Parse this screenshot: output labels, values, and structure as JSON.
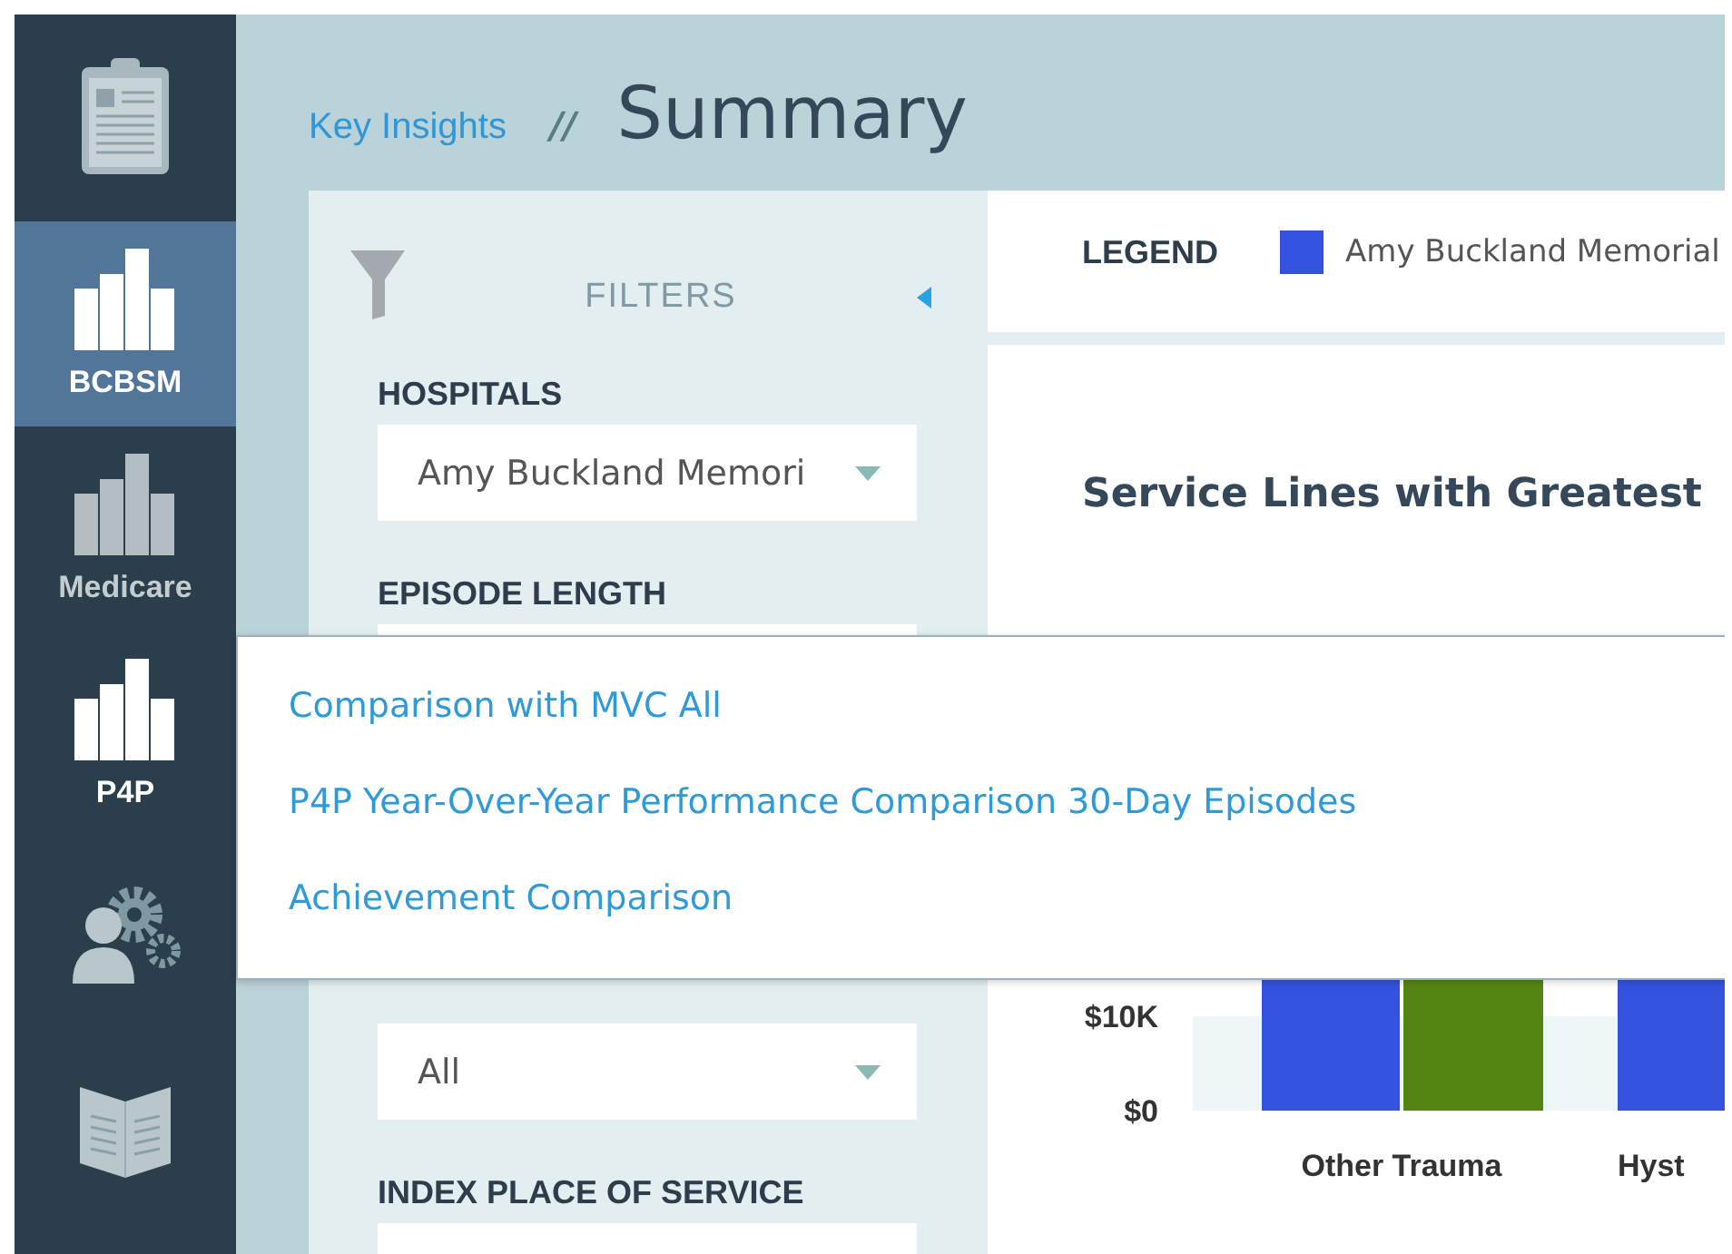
{
  "sidebar": {
    "items": [
      {
        "kind": "clipboard",
        "selected": false
      },
      {
        "kind": "chart",
        "label": "BCBSM",
        "selected": true,
        "muted": false
      },
      {
        "kind": "chart",
        "label": "Medicare",
        "selected": false,
        "muted": true
      },
      {
        "kind": "chart",
        "label": "P4P",
        "selected": false,
        "muted": false
      },
      {
        "kind": "people-gears",
        "selected": false
      },
      {
        "kind": "book",
        "selected": false
      }
    ]
  },
  "breadcrumb": {
    "parent": "Key Insights",
    "separator": "//",
    "title": "Summary"
  },
  "filters": {
    "title": "FILTERS",
    "groups": [
      {
        "label": "HOSPITALS",
        "value": "Amy Buckland Memori"
      },
      {
        "label": "EPISODE LENGTH"
      },
      {
        "value": "All"
      },
      {
        "label": "INDEX PLACE OF SERVICE"
      }
    ]
  },
  "legend": {
    "title": "LEGEND",
    "items": [
      {
        "label": "Amy Buckland Memorial",
        "color": "#3352dd"
      }
    ]
  },
  "chart": {
    "title": "Service Lines with Greatest",
    "y_tick_labels": [
      "$10K",
      "$0"
    ],
    "categories": [
      "Other Trauma",
      "Hyst"
    ]
  },
  "menu": {
    "items": [
      "Comparison with MVC All",
      "P4P Year-Over-Year Performance Comparison 30-Day Episodes",
      "Achievement Comparison"
    ]
  }
}
